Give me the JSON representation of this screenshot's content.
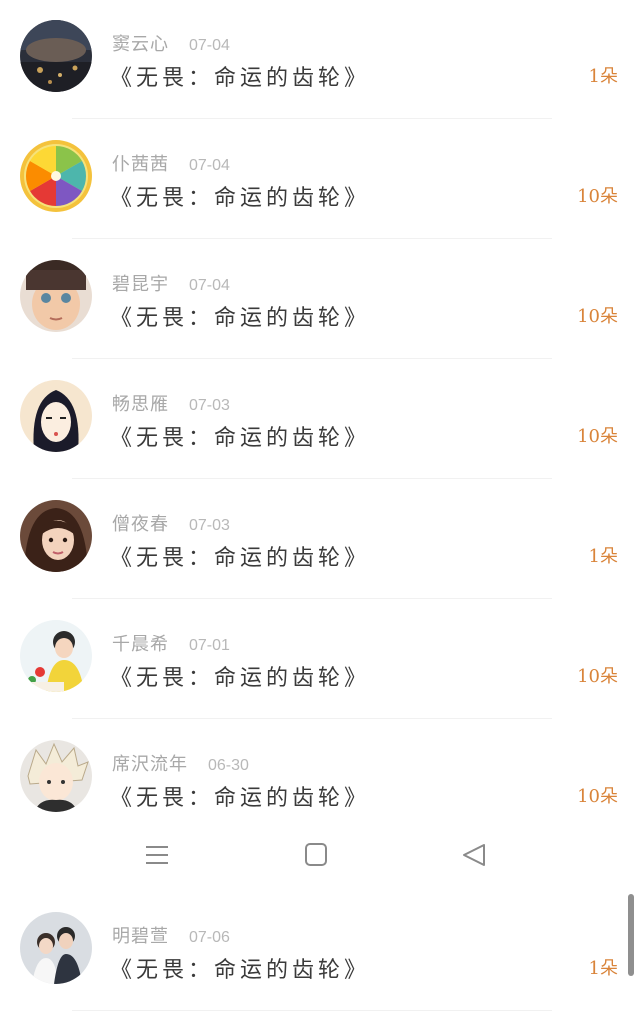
{
  "gift_records": [
    {
      "name": "窦云心",
      "date": "07-04",
      "gift": "《无畏：命运的齿轮》",
      "count": "1朵"
    },
    {
      "name": "仆茜茜",
      "date": "07-04",
      "gift": "《无畏：命运的齿轮》",
      "count": "10朵"
    },
    {
      "name": "碧昆宇",
      "date": "07-04",
      "gift": "《无畏：命运的齿轮》",
      "count": "10朵"
    },
    {
      "name": "畅思雁",
      "date": "07-03",
      "gift": "《无畏：命运的齿轮》",
      "count": "10朵"
    },
    {
      "name": "僧夜春",
      "date": "07-03",
      "gift": "《无畏：命运的齿轮》",
      "count": "1朵"
    },
    {
      "name": "千晨希",
      "date": "07-01",
      "gift": "《无畏：命运的齿轮》",
      "count": "10朵"
    },
    {
      "name": "席沢流年",
      "date": "06-30",
      "gift": "《无畏：命运的齿轮》",
      "count": "10朵"
    },
    {
      "name": "明碧萱",
      "date": "07-06",
      "gift": "《无畏：命运的齿轮》",
      "count": "1朵"
    }
  ],
  "navigation": {
    "menu_icon": "menu-icon",
    "home_icon": "home-square-icon",
    "back_icon": "back-triangle-icon"
  },
  "colors": {
    "count": "#d9843a",
    "name": "#a8a8a8",
    "gift": "#3a3a3a"
  }
}
